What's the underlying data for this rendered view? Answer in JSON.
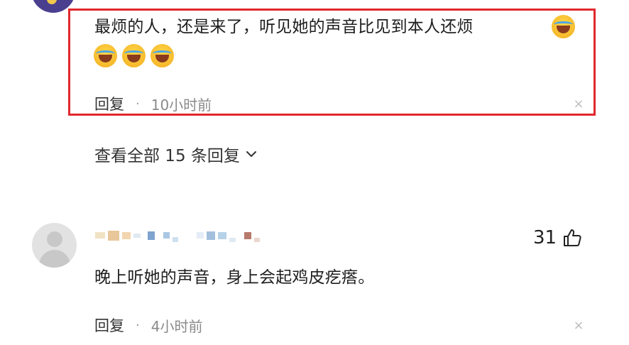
{
  "comment1": {
    "text": "最烦的人，还是来了，听见她的声音比见到本人还烦",
    "emoji_inline": "laugh-cry-icon",
    "emoji_row": [
      "laugh-cry-icon",
      "laugh-cry-icon",
      "laugh-cry-icon"
    ],
    "reply_label": "回复",
    "separator": "·",
    "time": "10小时前",
    "close_symbol": "×"
  },
  "view_all": {
    "label": "查看全部 15 条回复"
  },
  "comment2": {
    "username": "",
    "likes": "31",
    "text": "晚上听她的声音，身上会起鸡皮疙瘩。",
    "reply_label": "回复",
    "separator": "·",
    "time": "4小时前",
    "close_symbol": "×"
  },
  "colors": {
    "highlight_border": "#e0282e",
    "text_primary": "#1e1e1e",
    "text_meta": "#8a8a8a"
  }
}
